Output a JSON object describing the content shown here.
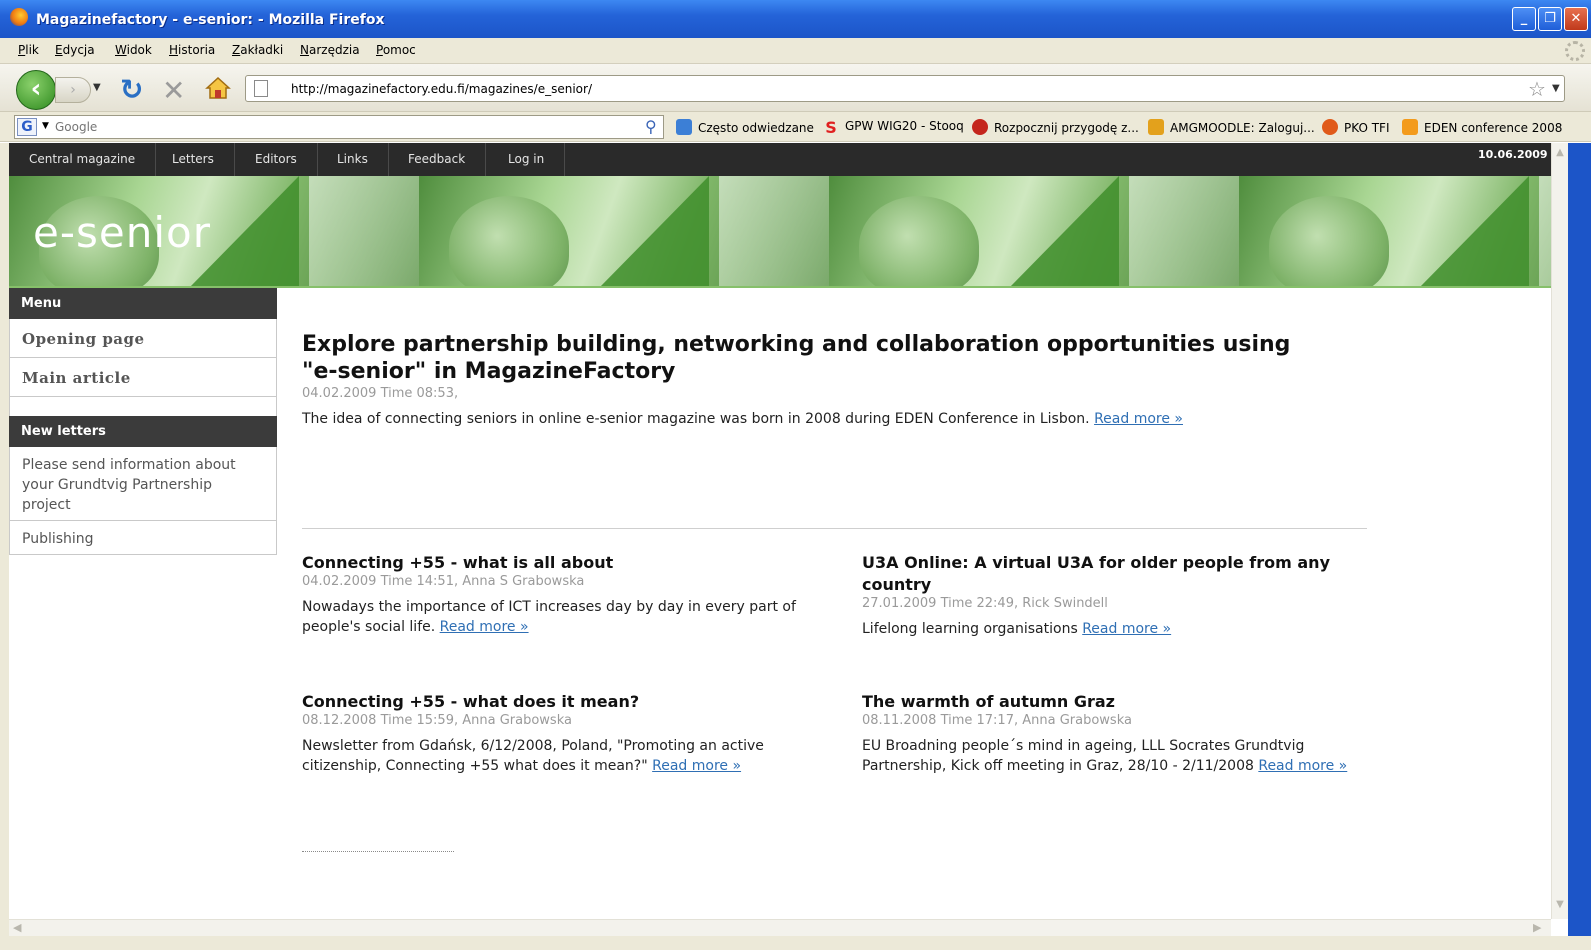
{
  "window": {
    "title": "Magazinefactory - e-senior: - Mozilla Firefox",
    "min": "_",
    "max": "❐",
    "close": "✕"
  },
  "menu": [
    "Plik",
    "Edycja",
    "Widok",
    "Historia",
    "Zakładki",
    "Narzędzia",
    "Pomoc"
  ],
  "nav": {
    "url": "http://magazinefactory.edu.fi/magazines/e_senior/"
  },
  "search": {
    "engine_icon": "G",
    "placeholder": "Google"
  },
  "bookmarks": [
    {
      "label": "Często odwiedzane",
      "icon": "bookmark-folder-icon",
      "color": "#3c7fd6"
    },
    {
      "label": "GPW WIG20 - Stooq",
      "icon": "stooq-icon",
      "color": "#e02020"
    },
    {
      "label": "Rozpocznij przygodę z...",
      "icon": "dragon-icon",
      "color": "#c4261d"
    },
    {
      "label": "AMGMOODLE: Zaloguj...",
      "icon": "moodle-icon",
      "color": "#e3a11c"
    },
    {
      "label": "PKO TFI",
      "icon": "pko-icon",
      "color": "#e05a1a"
    },
    {
      "label": "EDEN conference 2008",
      "icon": "rss-icon",
      "color": "#f39b1c"
    }
  ],
  "site": {
    "topnav": [
      "Central magazine",
      "Letters",
      "Editors",
      "Links",
      "Feedback",
      "Log in"
    ],
    "date": "10.06.2009",
    "logo": "e-senior",
    "accent_color": "#2f6fb4"
  },
  "sidebar": {
    "menu_heading": "Menu",
    "menu_items": [
      "Opening page",
      "Main article"
    ],
    "letters_heading": "New letters",
    "letters": [
      "Please send information about your Grundtvig Partnership project",
      "Publishing"
    ]
  },
  "lead": {
    "title": "Explore partnership building, networking and collaboration opportunities using \"e-senior\" in MagazineFactory",
    "meta": "04.02.2009 Time 08:53,",
    "body": "The idea of connecting seniors in online e-senior magazine was born in 2008 during EDEN Conference in Lisbon.",
    "read_more": "Read more »"
  },
  "articles": [
    {
      "title": "Connecting +55 - what is all about",
      "meta": "04.02.2009 Time 14:51, Anna S Grabowska",
      "body": "Nowadays the importance of ICT increases day by day in every part of people's social life.",
      "read_more": "Read more »"
    },
    {
      "title": "U3A Online: A virtual U3A for older people from any country",
      "meta": "27.01.2009 Time 22:49, Rick Swindell",
      "body": "Lifelong learning organisations",
      "read_more": "Read more »"
    },
    {
      "title": "Connecting +55 - what does it mean?",
      "meta": "08.12.2008 Time 15:59, Anna Grabowska",
      "body": "Newsletter from Gdańsk, 6/12/2008, Poland, \"Promoting an active citizenship, Connecting +55 what does it mean?\"",
      "read_more": "Read more »"
    },
    {
      "title": "The warmth of autumn Graz",
      "meta": "08.11.2008 Time 17:17, Anna Grabowska",
      "body": "EU Broadning people´s mind in ageing, LLL Socrates Grundtvig Partnership, Kick off meeting in Graz, 28/10 - 2/11/2008",
      "read_more": "Read more »"
    }
  ]
}
